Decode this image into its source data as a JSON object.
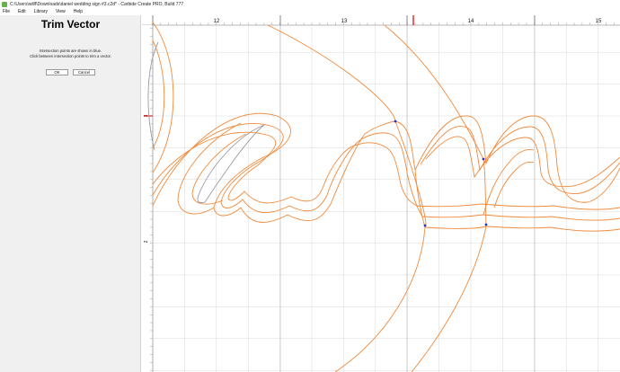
{
  "window": {
    "title": "C:\\Users\\willf\\Downloads\\daniel wedding sign #3.c2d* - Carbide Create PRO, Build 777"
  },
  "menu": {
    "items": [
      "File",
      "Edit",
      "Library",
      "View",
      "Help"
    ]
  },
  "panel": {
    "title": "Trim Vector",
    "line1": "Intersection points are shown in blue.",
    "line2": "Click between intersection points to trim a vector.",
    "ok_label": "OK",
    "cancel_label": "Cancel"
  },
  "ruler": {
    "top_labels": [
      "12",
      "13",
      "14",
      "15"
    ],
    "left_labels": [
      "3",
      "2"
    ]
  },
  "colors": {
    "vector": "#f08a3c",
    "selected": "#9a9aa8",
    "intersection": "#2233cc",
    "cursor": "#e02020"
  }
}
